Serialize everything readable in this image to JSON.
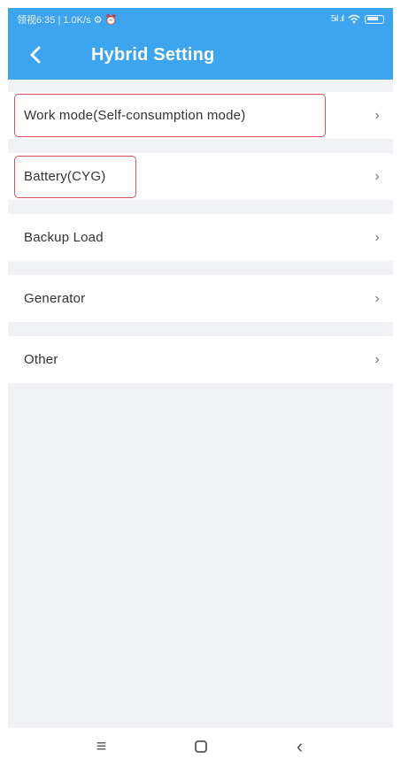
{
  "status_bar": {
    "left_text": "领视6:35 | 1.0K/s ⚙ ⏰",
    "signal_text": "5ıl .ıl"
  },
  "header": {
    "title": "Hybrid Setting",
    "back_icon": "chevron-left-icon"
  },
  "menu": {
    "items": [
      {
        "label": "Work mode(Self-consumption mode)",
        "highlighted": true
      },
      {
        "label": "Battery(CYG)",
        "highlighted": true
      },
      {
        "label": "Backup Load",
        "highlighted": false
      },
      {
        "label": "Generator",
        "highlighted": false
      },
      {
        "label": "Other",
        "highlighted": false
      }
    ],
    "chevron": "›"
  },
  "nav": {
    "menu_icon": "≡",
    "home_icon": "square-icon",
    "back_icon": "‹"
  },
  "colors": {
    "header": "#3da4f0",
    "highlight": "#d8505a",
    "background": "#f1f2f6"
  }
}
